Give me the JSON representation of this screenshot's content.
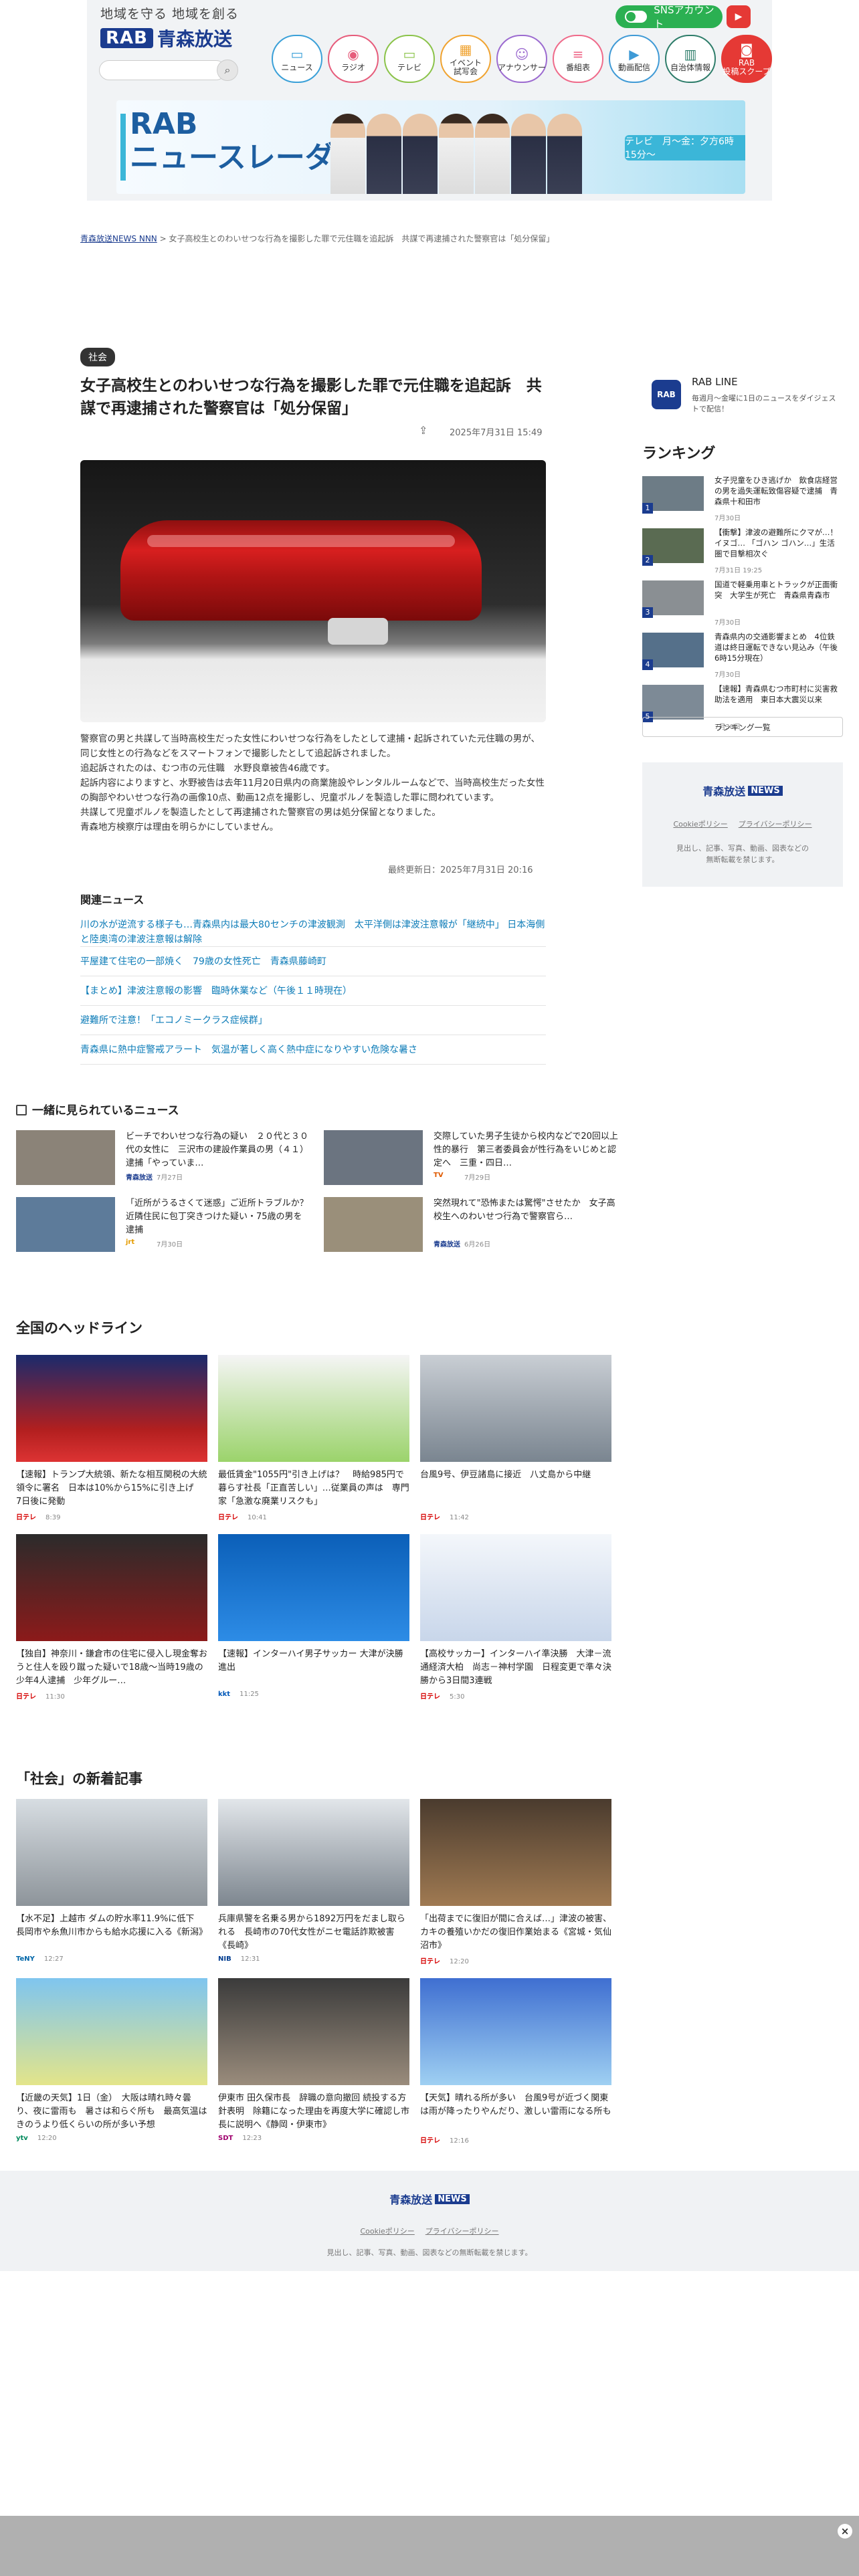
{
  "header": {
    "slogan": "地域を守る 地域を創る",
    "logo_rab": "RAB",
    "logo_name": "青森放送",
    "sns_label": "SNSアカウント",
    "nav": [
      {
        "label": "ニュース",
        "icon": "tv-icon"
      },
      {
        "label": "ラジオ",
        "icon": "radio-icon"
      },
      {
        "label": "テレビ",
        "icon": "tv-icon"
      },
      {
        "label": "イベント\n試写会",
        "icon": "calendar-icon"
      },
      {
        "label": "アナウンサー",
        "icon": "people-icon"
      },
      {
        "label": "番組表",
        "icon": "list-icon"
      },
      {
        "label": "動画配信",
        "icon": "video-icon"
      },
      {
        "label": "自治体情報",
        "icon": "building-icon"
      },
      {
        "label": "RAB\n投稿スクープ",
        "icon": "camera-icon"
      }
    ],
    "banner": {
      "line1": "RAB",
      "line2": "ニュースレーダー",
      "airtime": "テレビ　月〜金：夕方6時15分〜"
    }
  },
  "breadcrumb": {
    "home": "青森放送NEWS NNN",
    "sep": ">",
    "current": "女子高校生とのわいせつな行為を撮影した罪で元住職を追起訴　共謀で再逮捕された警察官は「処分保留」"
  },
  "article": {
    "category": "社会",
    "title": "女子高校生とのわいせつな行為を撮影した罪で元住職を追起訴　共謀で再逮捕された警察官は「処分保留」",
    "date": "2025年7月31日 15:49",
    "body": [
      "警察官の男と共謀して当時高校生だった女性にわいせつな行為をしたとして逮捕・起訴されていた元住職の男が、同じ女性との行為などをスマートフォンで撮影したとして追起訴されました。",
      "追起訴されたのは、むつ市の元住職　水野良章被告46歳です。",
      "起訴内容によりますと、水野被告は去年11月20日県内の商業施設やレンタルルームなどで、当時高校生だった女性の胸部やわいせつな行為の画像10点、動画12点を撮影し、児童ポルノを製造した罪に問われています。",
      "共謀して児童ポルノを製造したとして再逮捕された警察官の男は処分保留となりました。",
      "青森地方検察庁は理由を明らかにしていません。"
    ],
    "updated": "最終更新日：2025年7月31日 20:16"
  },
  "related": {
    "heading": "関連ニュース",
    "items": [
      "川の水が逆流する様子も…青森県内は最大80センチの津波観測　太平洋側は津波注意報が「継続中」 日本海側と陸奥湾の津波注意報は解除",
      "平屋建て住宅の一部焼く　79歳の女性死亡　青森県藤崎町",
      "【まとめ】津波注意報の影響　臨時休業など（午後１１時現在）",
      "避難所で注意！「エコノミークラス症候群」",
      "青森県に熱中症警戒アラート　気温が著しく高く熱中症になりやすい危険な暑さ"
    ]
  },
  "sidebar": {
    "rab_line": {
      "title": "RAB LINE",
      "desc": "毎週月〜金曜に1日のニュースをダイジェストで配信！",
      "icon_text": "RAB"
    },
    "ranking_heading": "ランキング",
    "ranking": [
      {
        "rank": "1",
        "title": "女子児童をひき逃げか　飲食店経営の男を過失運転致傷容疑で逮捕　青森県十和田市",
        "date": "7月30日"
      },
      {
        "rank": "2",
        "title": "【衝撃】津波の避難所にクマが…！イヌゴ… 「ゴハン ゴハン…」生活圏で目撃相次ぐ",
        "date": "7月31日 19:25"
      },
      {
        "rank": "3",
        "title": "国道で軽乗用車とトラックが正面衝突　大学生が死亡　青森県青森市",
        "date": "7月30日"
      },
      {
        "rank": "4",
        "title": "青森県内の交通影響まとめ　4位鉄道は終日運転できない見込み（午後6時15分現在）",
        "date": "7月30日"
      },
      {
        "rank": "5",
        "title": "【速報】青森県むつ市町村に災害救助法を適用　東日本大震災以来",
        "date": "7月30日"
      }
    ],
    "ranking_more": "ランキング一覧",
    "brand": "青森放送",
    "brand_news": "NEWS",
    "links": [
      "Cookieポリシー",
      "プライバシーポリシー"
    ],
    "note": "見出し、記事、写真、動画、図表などの無断転載を禁じます。"
  },
  "also_viewed": {
    "heading": "一緒に見られているニュース",
    "items": [
      {
        "title": "ビーチでわいせつな行為の疑い　２０代と３０代の女性に　三沢市の建設作業員の男（４１）逮捕「やっていま…",
        "source": "青森放送",
        "date": "7月27日",
        "color": "#1b3c8f"
      },
      {
        "title": "交際していた男子生徒から校内などで20回以上性的暴行　第三者委員会が性行為をいじめと認定へ　三重・四日…",
        "source": "TV",
        "date": "7月29日",
        "color": "#e05a00"
      },
      {
        "title": "「近所がうるさくて迷惑」ご近所トラブルか？近隣住民に包丁突きつけた疑い・75歳の男を逮捕",
        "source": "jrt",
        "date": "7月30日",
        "color": "#e59c00"
      },
      {
        "title": "突然現れて\"恐怖または驚愕\"させたか　女子高校生へのわいせつ行為で警察官ら…",
        "source": "青森放送",
        "date": "6月26日",
        "color": "#1b3c8f"
      }
    ]
  },
  "national": {
    "heading": "全国のヘッドライン",
    "items": [
      {
        "title": "【速報】トランプ大統領、新たな相互関税の大統領令に署名　日本は10%から15%に引き上げ　7日後に発動",
        "source": "日テレ",
        "time": "8:39",
        "color": "#d60000"
      },
      {
        "title": "最低賃金\"1055円\"引き上げは？　時給985円で暮らす社長「正直苦しい」…従業員の声は　専門家「急激な廃業リスクも」",
        "source": "日テレ",
        "time": "10:41",
        "color": "#d60000"
      },
      {
        "title": "台風9号、伊豆諸島に接近　八丈島から中継",
        "source": "日テレ",
        "time": "11:42",
        "color": "#d60000"
      },
      {
        "title": "【独自】神奈川・鎌倉市の住宅に侵入し現金奪おうと住人を殴り蹴った疑いで18歳〜当時19歳の少年4人逮捕　少年グルー…",
        "source": "日テレ",
        "time": "11:30",
        "color": "#d60000"
      },
      {
        "title": "【速報】インターハイ男子サッカー 大津が決勝進出",
        "source": "kkt",
        "time": "11:25",
        "color": "#0057b8"
      },
      {
        "title": "【高校サッカー】インターハイ準決勝　大津－流通経済大柏　尚志－神村学園　日程変更で準々決勝から3日間3連戦",
        "source": "日テレ",
        "time": "5:30",
        "color": "#d60000"
      }
    ]
  },
  "social": {
    "heading": "「社会」の新着記事",
    "items": [
      {
        "title": "【水不足】上越市 ダムの貯水率11.9%に低下　長岡市や糸魚川市からも給水応援に入る《新潟》",
        "source": "TeNY",
        "time": "12:27",
        "color": "#0066a8"
      },
      {
        "title": "兵庫県警を名乗る男から1892万円をだまし取られる　長崎市の70代女性がニセ電話詐欺被害《長崎》",
        "source": "NIB",
        "time": "12:31",
        "color": "#003c8f"
      },
      {
        "title": "「出荷までに復旧が間に合えば…」津波の被害、カキの養殖いかだの復旧作業始まる《宮城・気仙沼市》",
        "source": "日テレ",
        "time": "12:20",
        "color": "#d60000"
      },
      {
        "title": "【近畿の天気】1日（金）　大阪は晴れ時々曇り、夜に雷雨も　暑さは和らぐ所も　最高気温はきのうより低くらいの所が多い予想",
        "source": "ytv",
        "time": "12:20",
        "color": "#008a5c"
      },
      {
        "title": "伊東市 田久保市長　辞職の意向撤回 続投する方針表明　除籍になった理由を再度大学に確認し市長に説明へ《静岡・伊東市》",
        "source": "SDT",
        "time": "12:23",
        "color": "#a0006e"
      },
      {
        "title": "【天気】晴れる所が多い　台風9号が近づく関東は雨が降ったりやんだり、激しい雷雨になる所も",
        "source": "日テレ",
        "time": "12:16",
        "color": "#d60000"
      }
    ]
  },
  "footer": {
    "brand": "青森放送",
    "brand_news": "NEWS",
    "links": [
      "Cookieポリシー",
      "プライバシーポリシー"
    ],
    "note": "見出し、記事、写真、動画、図表などの無断転載を禁じます。"
  }
}
